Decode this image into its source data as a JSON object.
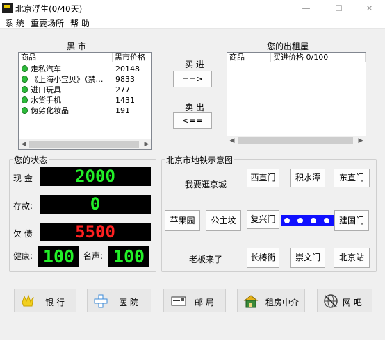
{
  "window": {
    "title": "北京浮生(0/40天)",
    "minimize": "—",
    "maximize": "☐",
    "close": "✕"
  },
  "menu": {
    "items": [
      "系 统",
      "重要场所",
      "帮 助"
    ]
  },
  "black_market": {
    "title": "黑 市",
    "headers": [
      "商品",
      "黑市价格"
    ],
    "items": [
      {
        "name": "走私汽车",
        "price": "20148"
      },
      {
        "name": "《上海小宝贝》（禁…",
        "price": "9833"
      },
      {
        "name": "进口玩具",
        "price": "277"
      },
      {
        "name": "水货手机",
        "price": "1431"
      },
      {
        "name": "伪劣化妆品",
        "price": "191"
      }
    ]
  },
  "trade": {
    "buy_label": "买 进",
    "buy_button": "==>",
    "sell_label": "卖 出",
    "sell_button": "<=="
  },
  "rental": {
    "title": "您的出租屋",
    "headers": [
      "商品",
      "买进价格 0/100"
    ]
  },
  "status": {
    "title": "您的状态",
    "cash_label": "现 金",
    "cash": "2000",
    "deposit_label": "存款:",
    "deposit": "0",
    "debt_label": "欠 债",
    "debt": "5500",
    "health_label": "健康:",
    "health": "100",
    "fame_label": "名声:",
    "fame": "100"
  },
  "subway": {
    "title": "北京市地铁示意图",
    "notes": [
      "我要逛京城",
      "老板来了"
    ],
    "stations": [
      "西直门",
      "积水潭",
      "东直门",
      "苹果园",
      "公主坟",
      "复兴门",
      "建国门",
      "长椿街",
      "崇文门",
      "北京站"
    ]
  },
  "places": [
    "银 行",
    "医 院",
    "邮 局",
    "租房中介",
    "网 吧"
  ],
  "colors": {
    "led_green": "#22f028",
    "led_red": "#ff2020",
    "subway_blue": "#1010ff"
  }
}
